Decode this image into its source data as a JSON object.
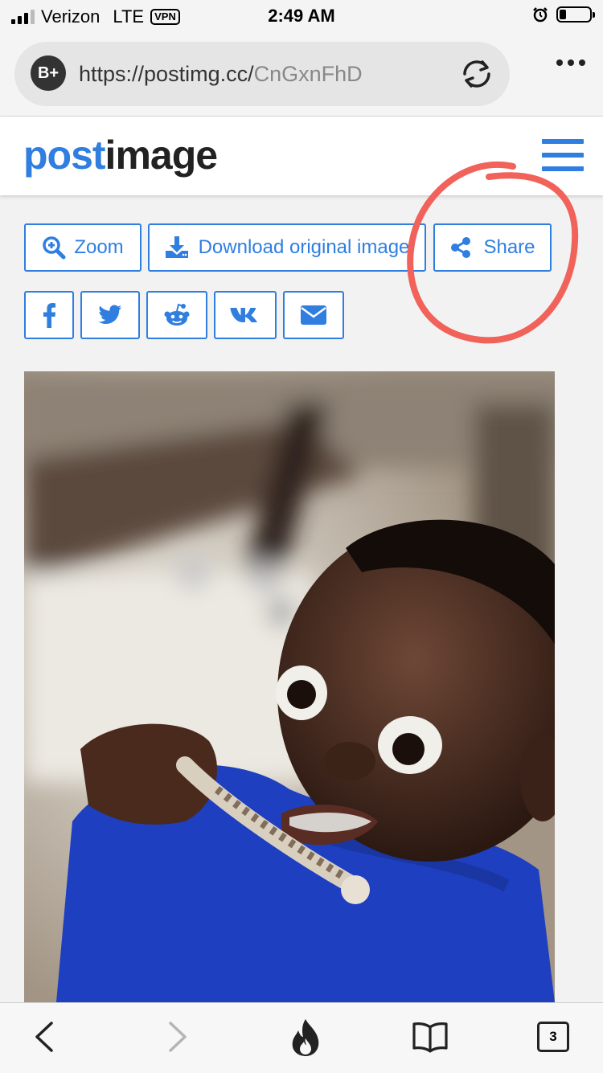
{
  "status_bar": {
    "carrier": "Verizon",
    "network": "LTE",
    "vpn_label": "VPN",
    "time": "2:49 AM"
  },
  "browser": {
    "badge": "B+",
    "url_domain": "https://postimg.cc/",
    "url_path": "CnGxnFhD",
    "open_tabs": "3"
  },
  "site": {
    "logo_part1": "post",
    "logo_part2": "image",
    "accent_color": "#2f7ee0"
  },
  "actions": {
    "zoom_label": "Zoom",
    "download_label": "Download original image",
    "share_label": "Share"
  },
  "social": [
    {
      "icon": "facebook-icon"
    },
    {
      "icon": "twitter-icon"
    },
    {
      "icon": "reddit-icon"
    },
    {
      "icon": "vk-icon"
    },
    {
      "icon": "email-icon"
    }
  ],
  "annotation": {
    "color": "#f0625a"
  }
}
